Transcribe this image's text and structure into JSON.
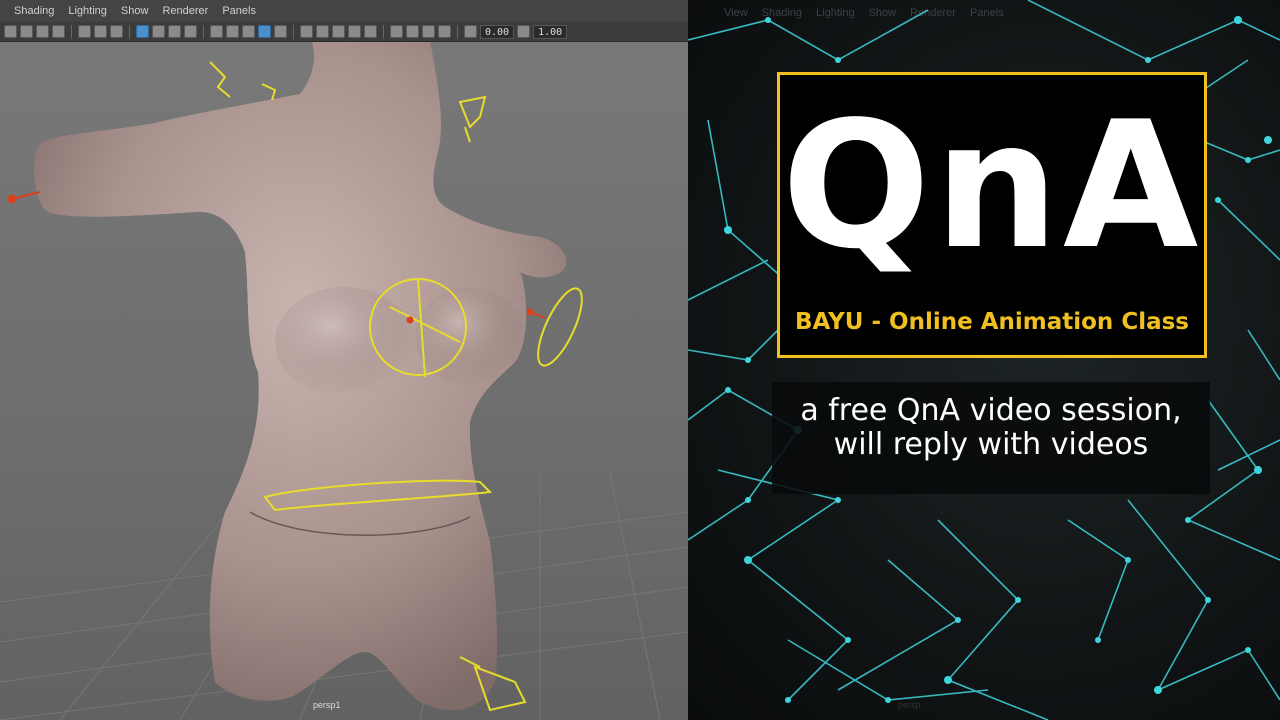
{
  "viewport": {
    "menu": [
      "Shading",
      "Lighting",
      "Show",
      "Renderer",
      "Panels"
    ],
    "toolbar": {
      "field1": "0.00",
      "field2": "1.00"
    },
    "camera_label": "persp1",
    "icons": [
      "select-tool-icon",
      "move-tool-icon",
      "camera-icon",
      "wireframe-icon",
      "shaded-icon",
      "light-icon",
      "grid-icon"
    ]
  },
  "promo": {
    "ghost_menu": [
      "View",
      "Shading",
      "Lighting",
      "Show",
      "Renderer",
      "Panels"
    ],
    "title": "QnA",
    "class_name": "BAYU - Online Animation Class",
    "description": [
      "a free QnA video session,",
      "will reply with videos"
    ],
    "camera_label": "persp",
    "colors": {
      "accent": "#f0c020",
      "network": "#3ed6dc"
    }
  }
}
